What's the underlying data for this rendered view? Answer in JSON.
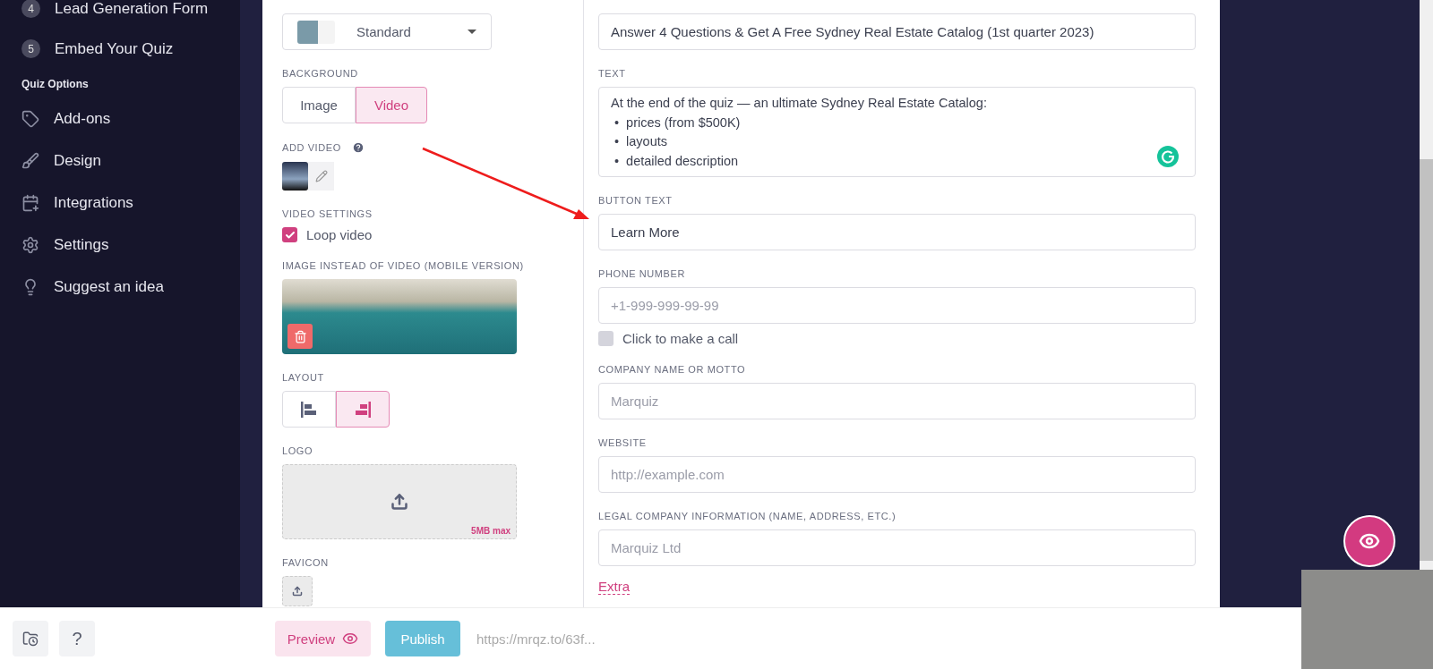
{
  "sidebar": {
    "steps": [
      {
        "number": "4",
        "label": "Lead Generation Form"
      },
      {
        "number": "5",
        "label": "Embed Your Quiz"
      }
    ],
    "section_title": "Quiz Options",
    "items": [
      {
        "kind": "tag",
        "label": "Add-ons"
      },
      {
        "kind": "brush",
        "label": "Design"
      },
      {
        "kind": "integrations",
        "label": "Integrations"
      },
      {
        "kind": "gear",
        "label": "Settings"
      },
      {
        "kind": "bulb",
        "label": "Suggest an idea"
      }
    ]
  },
  "left_panel": {
    "design": {
      "value": "Standard"
    },
    "background": {
      "label": "BACKGROUND",
      "options": [
        {
          "label": "Image",
          "selected": false
        },
        {
          "label": "Video",
          "selected": true
        }
      ]
    },
    "add_video": {
      "label": "ADD VIDEO"
    },
    "video_settings": {
      "label": "VIDEO SETTINGS",
      "loop": {
        "label": "Loop video",
        "checked": true
      }
    },
    "mobile_image": {
      "label": "IMAGE INSTEAD OF VIDEO (MOBILE VERSION)"
    },
    "layout": {
      "label": "LAYOUT",
      "options": [
        {
          "kind": "left",
          "selected": false
        },
        {
          "kind": "right",
          "selected": true
        }
      ]
    },
    "logo": {
      "label": "LOGO",
      "limit": "5MB max"
    },
    "favicon": {
      "label": "FAVICON"
    }
  },
  "right_panel": {
    "fields": [
      {
        "kind": "input",
        "value": "Answer 4 Questions & Get A Free Sydney Real Estate Catalog (1st quarter 2023)"
      },
      {
        "kind": "textarea",
        "label": "TEXT",
        "intro": "At the end of the quiz — an ultimate Sydney Real Estate Catalog:",
        "marker": "•",
        "bullets": [
          "prices (from $500K)",
          "layouts",
          "detailed description"
        ]
      },
      {
        "kind": "input",
        "label": "BUTTON TEXT",
        "value": "Learn More"
      },
      {
        "kind": "input",
        "label": "PHONE NUMBER",
        "placeholder": "+1-999-999-99-99",
        "option": {
          "label": "Click to make a call",
          "checked": false
        }
      },
      {
        "kind": "input",
        "label": "COMPANY NAME OR MOTTO",
        "placeholder": "Marquiz"
      },
      {
        "kind": "input",
        "label": "WEBSITE",
        "placeholder": "http://example.com"
      },
      {
        "kind": "input",
        "label": "LEGAL COMPANY INFORMATION (NAME, ADDRESS, ETC.)",
        "placeholder": "Marquiz Ltd"
      }
    ],
    "extra_link": "Extra"
  },
  "bottom_bar": {
    "help": "?",
    "preview": "Preview",
    "publish": "Publish",
    "url": "https://mrqz.to/63f..."
  }
}
